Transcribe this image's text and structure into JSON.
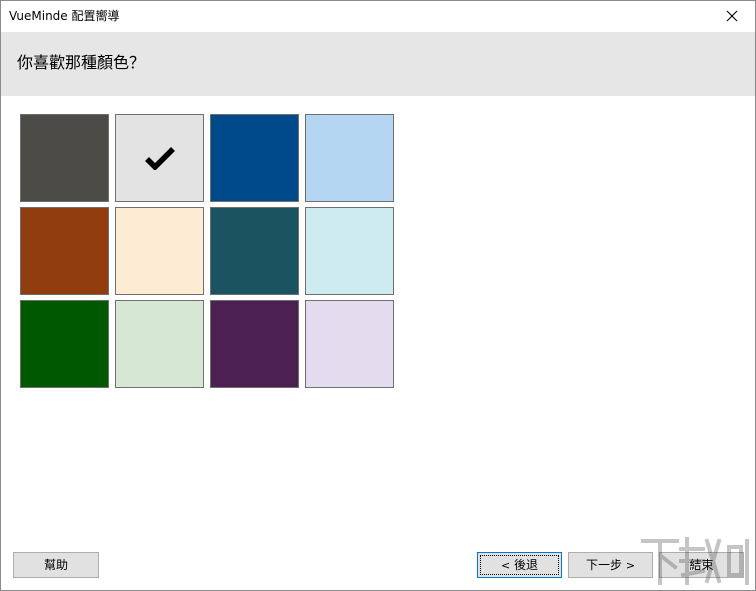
{
  "window": {
    "title": "VueMinde 配置嚮導"
  },
  "header": {
    "question": "你喜歡那種顏色？"
  },
  "colors": {
    "swatches": [
      {
        "color": "#4d4b48"
      },
      {
        "color": "#e3e3e3",
        "selected": true
      },
      {
        "color": "#004a8b"
      },
      {
        "color": "#b4d6f3"
      },
      {
        "color": "#913d0f"
      },
      {
        "color": "#fdebd3"
      },
      {
        "color": "#1c5360"
      },
      {
        "color": "#ceebf0"
      },
      {
        "color": "#005800"
      },
      {
        "color": "#d6e8d4"
      },
      {
        "color": "#4c2152"
      },
      {
        "color": "#e2dcee"
      }
    ],
    "selected_index": 1
  },
  "buttons": {
    "help": "幫助",
    "back": "後退",
    "back_arrow": "<",
    "next": "下一步",
    "next_arrow": ">",
    "finish": "結束"
  },
  "theme": {
    "header_bg": "#e6e6e6",
    "button_bg": "#e1e1e1",
    "focus_border": "#0078d7"
  }
}
